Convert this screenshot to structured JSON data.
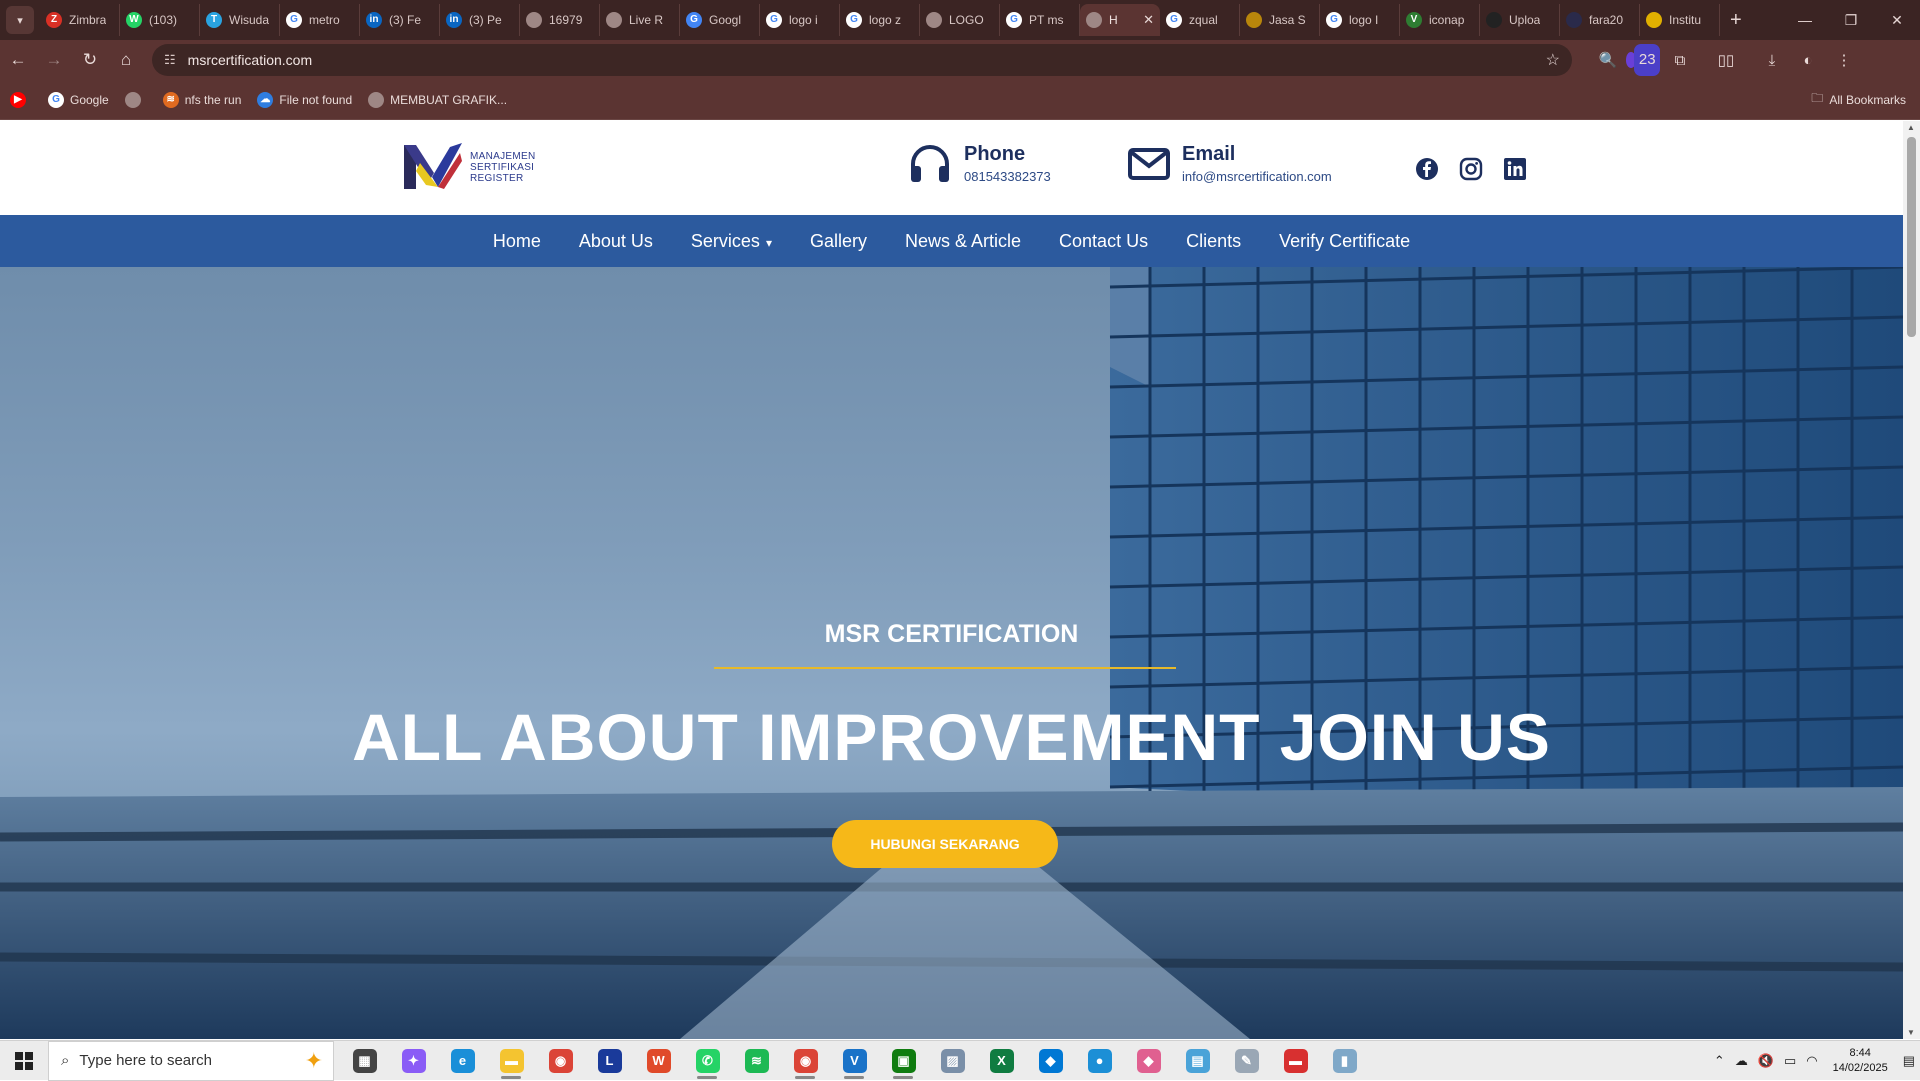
{
  "browser": {
    "tabs": [
      {
        "label": "Zimbra",
        "color": "#d93025",
        "glyph": "Z"
      },
      {
        "label": "(103)",
        "color": "#25d366",
        "glyph": "W"
      },
      {
        "label": "Wisuda",
        "color": "#2aa3e0",
        "glyph": "T"
      },
      {
        "label": "metro",
        "color": "#ffffff",
        "glyph": "G"
      },
      {
        "label": "(3) Fe",
        "color": "#0a66c2",
        "glyph": "in"
      },
      {
        "label": "(3) Pe",
        "color": "#0a66c2",
        "glyph": "in"
      },
      {
        "label": "16979",
        "color": "#9e8785",
        "glyph": ""
      },
      {
        "label": "Live R",
        "color": "#9e8785",
        "glyph": ""
      },
      {
        "label": "Googl",
        "color": "#4285f4",
        "glyph": "G"
      },
      {
        "label": "logo i",
        "color": "#ffffff",
        "glyph": "G"
      },
      {
        "label": "logo z",
        "color": "#ffffff",
        "glyph": "G"
      },
      {
        "label": "LOGO",
        "color": "#9e8785",
        "glyph": ""
      },
      {
        "label": "PT ms",
        "color": "#ffffff",
        "glyph": "G"
      },
      {
        "label": "H",
        "color": "#9e8785",
        "glyph": "",
        "active": true
      },
      {
        "label": "zqual",
        "color": "#ffffff",
        "glyph": "G"
      },
      {
        "label": "Jasa S",
        "color": "#b8860b",
        "glyph": ""
      },
      {
        "label": "logo I",
        "color": "#ffffff",
        "glyph": "G"
      },
      {
        "label": "iconap",
        "color": "#2e7d32",
        "glyph": "V"
      },
      {
        "label": "Uploa",
        "color": "#222222",
        "glyph": ""
      },
      {
        "label": "fara20",
        "color": "#2a2a4a",
        "glyph": ""
      },
      {
        "label": "Institu",
        "color": "#e0b000",
        "glyph": ""
      }
    ],
    "new_tab_glyph": "+",
    "address": "msrcertification.com",
    "extension_badge": "23",
    "bookmarks": [
      {
        "label": "",
        "color": "#ff0000",
        "glyph": "▶"
      },
      {
        "label": "Google",
        "color": "#ffffff",
        "glyph": "G"
      },
      {
        "label": "",
        "color": "#9e8785",
        "glyph": ""
      },
      {
        "label": "nfs the run",
        "color": "#e06a20",
        "glyph": "≋"
      },
      {
        "label": "File not found",
        "color": "#2f7de0",
        "glyph": "☁"
      },
      {
        "label": "MEMBUAT GRAFIK...",
        "color": "#9e8785",
        "glyph": ""
      }
    ],
    "all_bookmarks": "All Bookmarks"
  },
  "site": {
    "logo_lines": [
      "MANAJEMEN",
      "SERTIFIKASI",
      "REGISTER"
    ],
    "phone": {
      "title": "Phone",
      "value": "081543382373"
    },
    "email": {
      "title": "Email",
      "value": "info@msrcertification.com"
    },
    "nav": [
      "Home",
      "About Us",
      "Services",
      "Gallery",
      "News & Article",
      "Contact Us",
      "Clients",
      "Verify Certificate"
    ],
    "hero": {
      "subtitle": "MSR CERTIFICATION",
      "title": "ALL ABOUT IMPROVEMENT JOIN US",
      "button": "HUBUNGI SEKARANG"
    }
  },
  "taskbar": {
    "search_placeholder": "Type here to search",
    "apps": [
      {
        "name": "task-view",
        "color": "#444444",
        "glyph": "▦"
      },
      {
        "name": "copilot",
        "color": "#8a5cf6",
        "glyph": "✦"
      },
      {
        "name": "edge",
        "color": "#1a8fd8",
        "glyph": "e"
      },
      {
        "name": "file-explorer",
        "color": "#f4c430",
        "glyph": "▬",
        "running": true
      },
      {
        "name": "chrome",
        "color": "#db4437",
        "glyph": "◉"
      },
      {
        "name": "l-app",
        "color": "#1a3a9a",
        "glyph": "L"
      },
      {
        "name": "wps",
        "color": "#e04a2a",
        "glyph": "W"
      },
      {
        "name": "whatsapp",
        "color": "#25d366",
        "glyph": "✆",
        "running": true
      },
      {
        "name": "spotify",
        "color": "#1db954",
        "glyph": "≋"
      },
      {
        "name": "chrome-profile",
        "color": "#db4437",
        "glyph": "◉",
        "running": true
      },
      {
        "name": "vs",
        "color": "#1a73c8",
        "glyph": "V",
        "running": true
      },
      {
        "name": "terminal",
        "color": "#107c10",
        "glyph": "▣",
        "running": true
      },
      {
        "name": "photos",
        "color": "#7a8fa8",
        "glyph": "▨"
      },
      {
        "name": "excel",
        "color": "#107c41",
        "glyph": "X"
      },
      {
        "name": "vscode",
        "color": "#0078d4",
        "glyph": "◆"
      },
      {
        "name": "app-blue",
        "color": "#1c8fd6",
        "glyph": "●"
      },
      {
        "name": "app-diamond",
        "color": "#e06090",
        "glyph": "◆"
      },
      {
        "name": "app-screen",
        "color": "#4aa3d8",
        "glyph": "▤"
      },
      {
        "name": "app-tool",
        "color": "#9aa7b5",
        "glyph": "✎"
      },
      {
        "name": "app-flag",
        "color": "#d83030",
        "glyph": "▬"
      },
      {
        "name": "app-doc",
        "color": "#7fa8c8",
        "glyph": "▮"
      }
    ],
    "time": "8:44",
    "date": "14/02/2025",
    "tray_glyphs": [
      "⌃",
      "☁",
      "🔇",
      "▭",
      "◠"
    ],
    "notification_glyph": "▤"
  }
}
